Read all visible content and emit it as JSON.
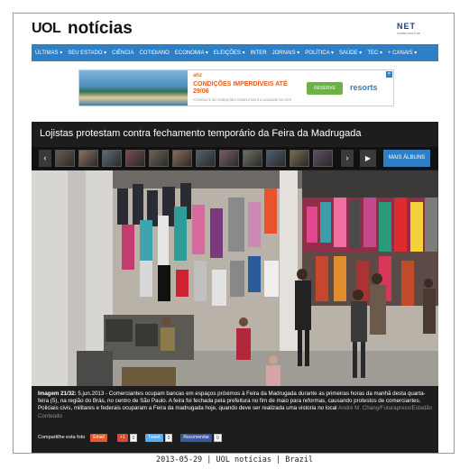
{
  "header": {
    "logo_uol": "UOL",
    "logo_noticias": "notícias",
    "partner_logo": "NET",
    "partner_subtext": "COMBO MULTI HD"
  },
  "nav": {
    "items": [
      "ÚLTIMAS ▾",
      "SEU ESTADO ▾",
      "CIÊNCIA",
      "COTIDIANO",
      "ECONOMIA ▾",
      "ELEIÇÕES ▾",
      "INTER",
      "JORNAIS ▾",
      "POLÍTICA ▾",
      "SAÚDE ▾",
      "TEC ▾",
      "+ CANAIS ▾"
    ]
  },
  "ad": {
    "logo": "ahz",
    "headline": "CONDIÇÕES IMPERDÍVEIS ATÉ 29/06",
    "cta": "RESERVE",
    "brand": "resorts",
    "footnote": "*CONSULTE AS CONDIÇÕES COMPLETAS E A VALIDADE NO SITE",
    "close": "✕"
  },
  "gallery": {
    "title": "Lojistas protestam contra fechamento temporário da Feira da Madrugada",
    "prev_icon": "‹",
    "next_icon": "›",
    "play_icon": "▶",
    "more_albums": "MAIS ÁLBUNS",
    "thumbnail_count": 12
  },
  "caption": {
    "label": "Imagem 21/32:",
    "text": " 5.jun.2013 - Comerciantes ocupam bancas em espaços próximos à Feira da Madrugada durante as primeiras horas da manhã desta quarta-feira (5), na região do Brás, no centro de São Paulo. A feira foi fechada pela prefeitura no fim de maio para reformas, causando protestos de comerciantes. Policiais civis, militares e federais ocuparam a Feira da madrugada hoje, quando deve ser realizada uma vistoria no local",
    "credit": "André M. Chang/Futurapress/Estadão Conteúdo"
  },
  "share": {
    "label": "Compartilhe esta foto",
    "email": "Email",
    "gplus": "+1",
    "gplus_count": "0",
    "twitter": "Tweet",
    "twitter_count": "0",
    "facebook": "Recomendar",
    "facebook_count": "0"
  },
  "footer": {
    "text": "2013-05-29 | UOL notícias | Brazil"
  },
  "colors": {
    "nav_bg": "#2f7fc6",
    "gallery_bg": "#1d1d1d",
    "email_btn": "#e05a2b",
    "gplus_btn": "#d34836",
    "twitter_btn": "#55acee",
    "facebook_btn": "#3b5998"
  }
}
